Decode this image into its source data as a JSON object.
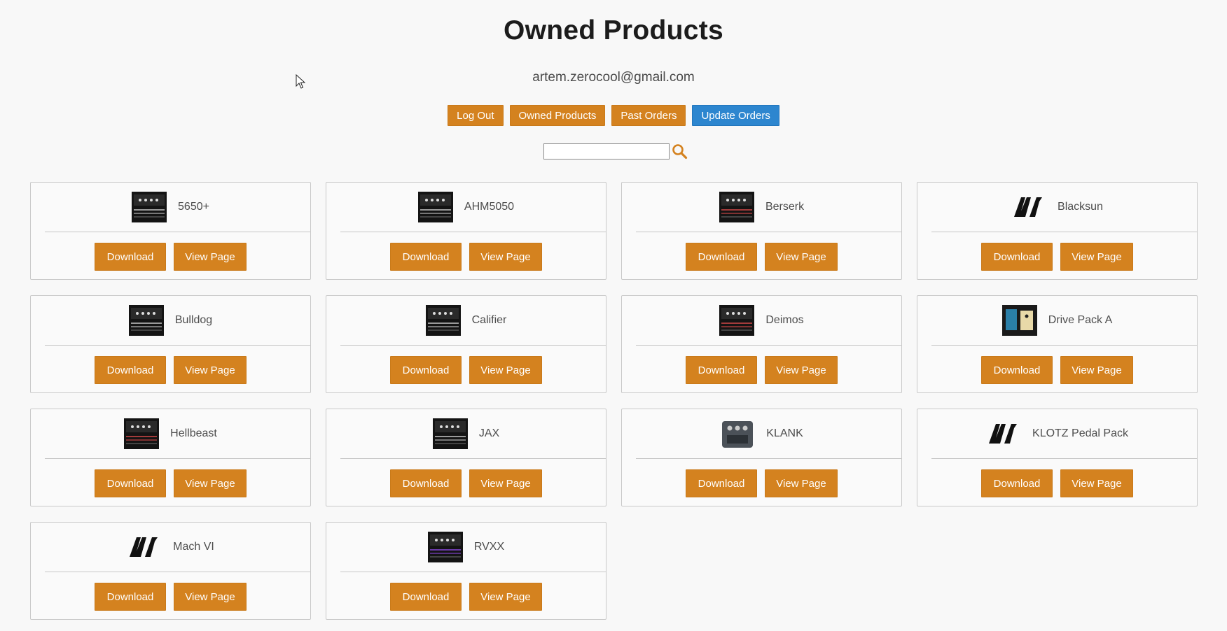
{
  "page": {
    "title": "Owned Products",
    "email": "artem.zerocool@gmail.com"
  },
  "nav": {
    "logout": "Log Out",
    "owned": "Owned Products",
    "past": "Past Orders",
    "update": "Update Orders"
  },
  "search": {
    "value": "",
    "icon": "search-icon"
  },
  "card_labels": {
    "download": "Download",
    "view": "View Page"
  },
  "products": [
    {
      "name": "5650+",
      "thumb": "amp"
    },
    {
      "name": "AHM5050",
      "thumb": "amp"
    },
    {
      "name": "Berserk",
      "thumb": "amp-red"
    },
    {
      "name": "Blacksun",
      "thumb": "logo"
    },
    {
      "name": "Bulldog",
      "thumb": "amp"
    },
    {
      "name": "Califier",
      "thumb": "amp"
    },
    {
      "name": "Deimos",
      "thumb": "amp-red"
    },
    {
      "name": "Drive Pack A",
      "thumb": "pedal"
    },
    {
      "name": "Hellbeast",
      "thumb": "amp-red"
    },
    {
      "name": "JAX",
      "thumb": "amp"
    },
    {
      "name": "KLANK",
      "thumb": "pedal-gray"
    },
    {
      "name": "KLOTZ Pedal Pack",
      "thumb": "logo"
    },
    {
      "name": "Mach VI",
      "thumb": "logo"
    },
    {
      "name": "RVXX",
      "thumb": "amp-violet"
    }
  ],
  "colors": {
    "orange": "#d4821f",
    "blue": "#2d86cf"
  }
}
